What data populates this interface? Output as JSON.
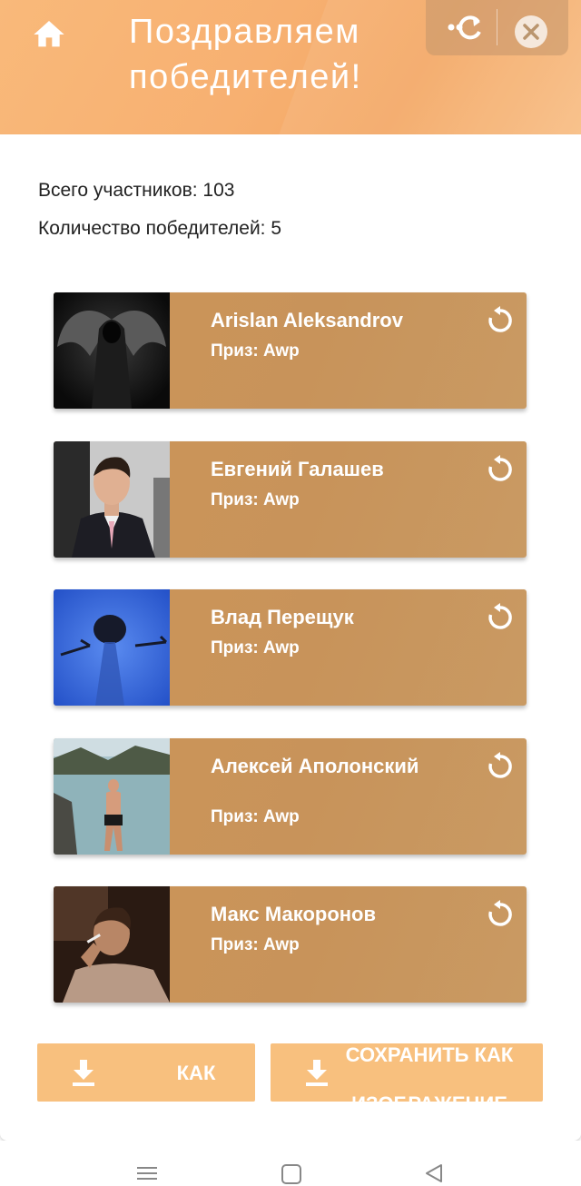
{
  "header": {
    "title": "Поздравляем победителей!",
    "icons": [
      "home-icon",
      "more-icon",
      "close-icon"
    ]
  },
  "stats": {
    "total": "Всего участников: 103",
    "winners": "Количество победителей: 5"
  },
  "winners": [
    {
      "name": "Arislan Aleksandrov",
      "prize": "Приз: Awp",
      "avatar": "winged-dark-figure"
    },
    {
      "name": "Евгений Галашев",
      "prize": "Приз: Awp",
      "avatar": "man-in-suit"
    },
    {
      "name": "Влад Перещук",
      "prize": "Приз: Awp",
      "avatar": "blue-figure"
    },
    {
      "name": "Алексей Аполонский",
      "prize": "Приз: Awp",
      "avatar": "man-by-river"
    },
    {
      "name": "Макс Макоронов",
      "prize": "Приз: Awp",
      "avatar": "man-smoking"
    }
  ],
  "buttons": {
    "save_left": "КАК",
    "save_right": "СОХРАНИТЬ КАК ИЗОБРАЖЕНИЕ"
  },
  "colors": {
    "header": "#f7b071",
    "card": "#c99357",
    "button": "#f8c07e"
  }
}
